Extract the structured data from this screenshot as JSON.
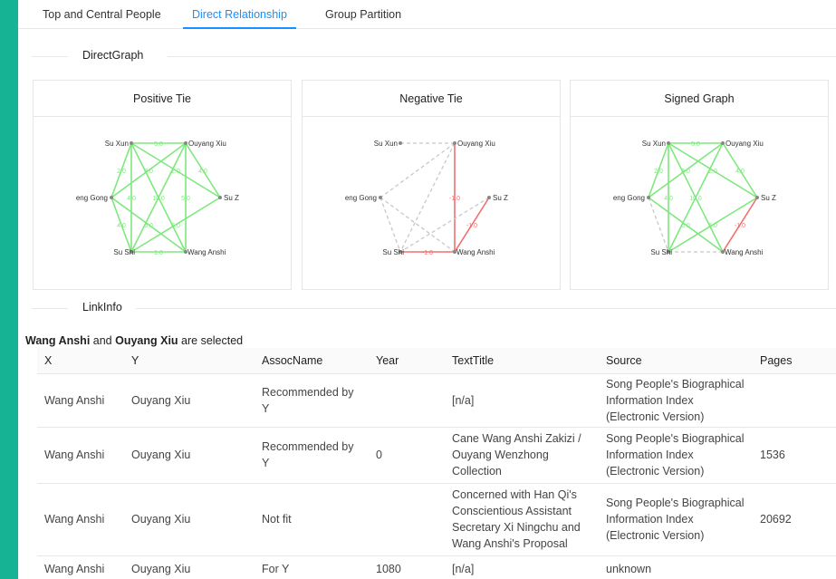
{
  "tabs": [
    {
      "label": "Top and Central People",
      "active": false
    },
    {
      "label": "Direct Relationship",
      "active": true
    },
    {
      "label": "Group Partition",
      "active": false
    }
  ],
  "sections": {
    "direct_graph": "DirectGraph",
    "link_info": "LinkInfo"
  },
  "colors": {
    "accent": "#1890ff",
    "positive": "#7ee87e",
    "negative": "#f07070",
    "neutral": "#c8c8c8",
    "frame": "#16b395"
  },
  "graphs": [
    {
      "title": "Positive Tie",
      "nodes": [
        {
          "id": "SuXun",
          "label": "Su Xun"
        },
        {
          "id": "Ouyang",
          "label": "Ouyang Xiu"
        },
        {
          "id": "Gong",
          "label": "eng Gong"
        },
        {
          "id": "SuZ",
          "label": "Su Z"
        },
        {
          "id": "SuShi",
          "label": "Su Shi"
        },
        {
          "id": "Wang",
          "label": "Wang Anshi"
        }
      ],
      "edges": [
        {
          "from": "SuXun",
          "to": "Ouyang",
          "type": "positive",
          "label": "5.0"
        },
        {
          "from": "SuXun",
          "to": "Gong",
          "type": "positive",
          "label": "2.0"
        },
        {
          "from": "SuXun",
          "to": "SuShi",
          "type": "positive",
          "label": "4.0"
        },
        {
          "from": "SuXun",
          "to": "SuZ",
          "type": "positive",
          "label": "2.0"
        },
        {
          "from": "SuXun",
          "to": "Wang",
          "type": "positive",
          "label": ""
        },
        {
          "from": "Ouyang",
          "to": "Gong",
          "type": "positive",
          "label": "3.0"
        },
        {
          "from": "Ouyang",
          "to": "SuShi",
          "type": "positive",
          "label": "10.0"
        },
        {
          "from": "Ouyang",
          "to": "SuZ",
          "type": "positive",
          "label": "4.0"
        },
        {
          "from": "Ouyang",
          "to": "Wang",
          "type": "positive",
          "label": "5.0"
        },
        {
          "from": "Gong",
          "to": "SuShi",
          "type": "positive",
          "label": "4.0"
        },
        {
          "from": "Gong",
          "to": "Wang",
          "type": "positive",
          "label": "6.0"
        },
        {
          "from": "SuZ",
          "to": "SuShi",
          "type": "positive",
          "label": "6.0"
        },
        {
          "from": "SuShi",
          "to": "Wang",
          "type": "positive",
          "label": "1.0"
        }
      ]
    },
    {
      "title": "Negative Tie",
      "nodes": [
        {
          "id": "SuXun",
          "label": "Su Xun"
        },
        {
          "id": "Ouyang",
          "label": "Ouyang Xiu"
        },
        {
          "id": "Gong",
          "label": "eng Gong"
        },
        {
          "id": "SuZ",
          "label": "Su Z"
        },
        {
          "id": "SuShi",
          "label": "Su Shi"
        },
        {
          "id": "Wang",
          "label": "Wang Anshi"
        }
      ],
      "edges": [
        {
          "from": "SuXun",
          "to": "Ouyang",
          "type": "neutral",
          "label": ""
        },
        {
          "from": "Ouyang",
          "to": "Gong",
          "type": "neutral",
          "label": ""
        },
        {
          "from": "Ouyang",
          "to": "SuShi",
          "type": "neutral",
          "label": ""
        },
        {
          "from": "Ouyang",
          "to": "Wang",
          "type": "negative",
          "label": "-1.0"
        },
        {
          "from": "Gong",
          "to": "SuShi",
          "type": "neutral",
          "label": ""
        },
        {
          "from": "Gong",
          "to": "Wang",
          "type": "neutral",
          "label": ""
        },
        {
          "from": "SuZ",
          "to": "SuShi",
          "type": "neutral",
          "label": ""
        },
        {
          "from": "SuZ",
          "to": "Wang",
          "type": "negative",
          "label": "-1.0"
        },
        {
          "from": "SuShi",
          "to": "Wang",
          "type": "negative",
          "label": "-1.0"
        }
      ]
    },
    {
      "title": "Signed Graph",
      "nodes": [
        {
          "id": "SuXun",
          "label": "Su Xun"
        },
        {
          "id": "Ouyang",
          "label": "Ouyang Xiu"
        },
        {
          "id": "Gong",
          "label": "eng Gong"
        },
        {
          "id": "SuZ",
          "label": "Su Z"
        },
        {
          "id": "SuShi",
          "label": "Su Shi"
        },
        {
          "id": "Wang",
          "label": "Wang Anshi"
        }
      ],
      "edges": [
        {
          "from": "SuXun",
          "to": "Ouyang",
          "type": "positive",
          "label": "5.0"
        },
        {
          "from": "SuXun",
          "to": "Gong",
          "type": "positive",
          "label": "2.0"
        },
        {
          "from": "SuXun",
          "to": "SuShi",
          "type": "positive",
          "label": "4.0"
        },
        {
          "from": "SuXun",
          "to": "SuZ",
          "type": "positive",
          "label": "2.0"
        },
        {
          "from": "SuXun",
          "to": "Wang",
          "type": "positive",
          "label": ""
        },
        {
          "from": "Ouyang",
          "to": "Gong",
          "type": "positive",
          "label": "3.0"
        },
        {
          "from": "Ouyang",
          "to": "SuShi",
          "type": "positive",
          "label": "10.0"
        },
        {
          "from": "Ouyang",
          "to": "SuZ",
          "type": "positive",
          "label": "4.0"
        },
        {
          "from": "Gong",
          "to": "SuShi",
          "type": "neutral",
          "label": ""
        },
        {
          "from": "Gong",
          "to": "Wang",
          "type": "positive",
          "label": "6.0"
        },
        {
          "from": "SuZ",
          "to": "SuShi",
          "type": "positive",
          "label": "6.0"
        },
        {
          "from": "SuZ",
          "to": "Wang",
          "type": "negative",
          "label": "-1.0"
        },
        {
          "from": "SuShi",
          "to": "Wang",
          "type": "neutral",
          "label": ""
        }
      ]
    }
  ],
  "selection": {
    "person_a": "Wang Anshi",
    "conj": " and ",
    "person_b": "Ouyang Xiu",
    "suffix": " are selected"
  },
  "table": {
    "headers": [
      "X",
      "Y",
      "AssocName",
      "Year",
      "TextTitle",
      "Source",
      "Pages"
    ],
    "rows": [
      [
        "Wang Anshi",
        "Ouyang Xiu",
        "Recommended by Y",
        "",
        "[n/a]",
        "Song People's Biographical Information Index (Electronic Version)",
        ""
      ],
      [
        "Wang Anshi",
        "Ouyang Xiu",
        "Recommended by Y",
        "0",
        "Cane Wang Anshi Zakizi / Ouyang Wenzhong Collection",
        "Song People's Biographical Information Index (Electronic Version)",
        "1536"
      ],
      [
        "Wang Anshi",
        "Ouyang Xiu",
        "Not fit",
        "",
        "Concerned with Han Qi's Conscientious Assistant Secretary Xi Ningchu and Wang Anshi's Proposal",
        "Song People's Biographical Information Index (Electronic Version)",
        "20692"
      ],
      [
        "Wang Anshi",
        "Ouyang Xiu",
        "For Y",
        "1080",
        "[n/a]",
        "unknown",
        ""
      ]
    ]
  }
}
